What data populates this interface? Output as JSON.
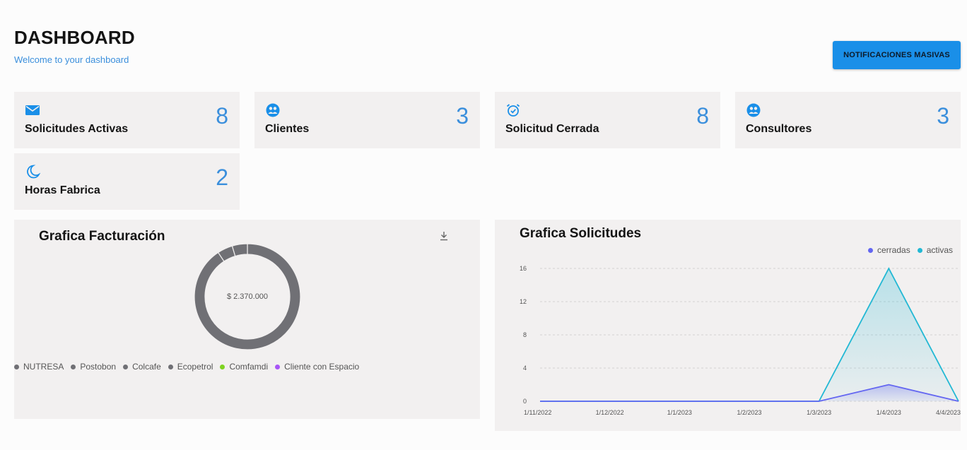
{
  "header": {
    "title": "DASHBOARD",
    "subtitle": "Welcome to your dashboard",
    "action_button": "NOTIFICACIONES MASIVAS"
  },
  "stats": [
    {
      "label": "Solicitudes Activas",
      "value": "8",
      "icon": "mail-icon"
    },
    {
      "label": "Clientes",
      "value": "3",
      "icon": "users-icon"
    },
    {
      "label": "Solicitud Cerrada",
      "value": "8",
      "icon": "alarm-clock-icon"
    },
    {
      "label": "Consultores",
      "value": "3",
      "icon": "users-icon"
    },
    {
      "label": "Horas Fabrica",
      "value": "2",
      "icon": "moon-icon"
    }
  ],
  "colors": {
    "accent": "#3b8fdc",
    "button": "#1a8fe8",
    "card_bg": "#f2f0f0",
    "cerradas": "#6366f1",
    "activas": "#22b8d4"
  },
  "pie_panel": {
    "title": "Grafica Facturación",
    "total_label": "$ 2.370.000",
    "download_icon": "download-icon"
  },
  "line_panel": {
    "title": "Grafica Solicitudes"
  },
  "chart_data": [
    {
      "type": "pie",
      "variant": "donut",
      "title": "Grafica Facturación",
      "center_label": "$ 2.370.000",
      "legend": [
        {
          "name": "NUTRESA",
          "color": "#707075"
        },
        {
          "name": "Postobon",
          "color": "#707075"
        },
        {
          "name": "Colcafe",
          "color": "#707075"
        },
        {
          "name": "Ecopetrol",
          "color": "#707075"
        },
        {
          "name": "Comfamdi",
          "color": "#7ed321"
        },
        {
          "name": "Cliente con Espacio",
          "color": "#a855f7"
        }
      ],
      "slices": [
        {
          "name": "NUTRESA",
          "value": 2150000
        },
        {
          "name": "Postobon",
          "value": 110000
        },
        {
          "name": "Colcafe",
          "value": 110000
        }
      ]
    },
    {
      "type": "line",
      "title": "Grafica Solicitudes",
      "categories": [
        "1/11/2022",
        "1/12/2022",
        "1/1/2023",
        "1/2/2023",
        "1/3/2023",
        "1/4/2023",
        "4/4/2023"
      ],
      "series": [
        {
          "name": "cerradas",
          "values": [
            0,
            0,
            0,
            0,
            0,
            2,
            0
          ],
          "color": "#6366f1"
        },
        {
          "name": "activas",
          "values": [
            0,
            0,
            0,
            0,
            0,
            16,
            0
          ],
          "color": "#22b8d4"
        }
      ],
      "yticks": [
        0,
        4,
        8,
        12,
        16
      ],
      "ylim": [
        0,
        16
      ],
      "grid": true,
      "legend_position": "top-right"
    }
  ]
}
